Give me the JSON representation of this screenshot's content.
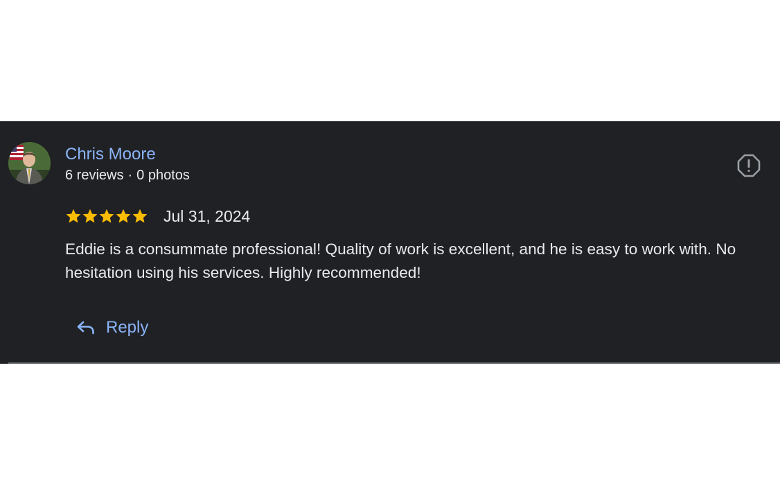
{
  "review": {
    "author": {
      "name": "Chris Moore",
      "reviews": "6 reviews",
      "separator": "·",
      "photos": "0 photos"
    },
    "rating": 5,
    "rating_max": 5,
    "date": "Jul 31, 2024",
    "text": "Eddie is a consummate professional! Quality of work is excellent, and he is easy to work with. No hesitation using his services. Highly recommended!",
    "reply_label": "Reply"
  },
  "icons": {
    "report": "report-icon",
    "reply": "reply-arrow-icon",
    "star": "star-icon"
  },
  "colors": {
    "background": "#202124",
    "link": "#8ab4f8",
    "text": "#e8eaed",
    "star": "#fbbc04",
    "icon": "#9aa0a6"
  }
}
